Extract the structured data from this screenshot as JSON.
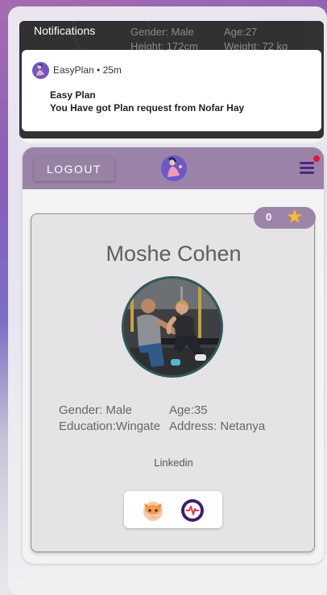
{
  "notification_shade": {
    "header": "Notifications",
    "underlay": {
      "gender": "Gender: Male",
      "age": "Age:27",
      "height": "Height: 172cm",
      "weight": "Weight: 72  kg"
    },
    "notification": {
      "app_name": "EasyPlan",
      "time": "25m",
      "app_line": "EasyPlan • 25m",
      "title": "Easy Plan",
      "body": "You Have got Plan request from Nofar Hay"
    }
  },
  "appbar": {
    "logout_label": "LOGOUT",
    "logo_icon": "easyplan-logo-icon",
    "menu_icon": "hamburger-menu-icon",
    "menu_badge_color": "#e3163a"
  },
  "profile": {
    "rating_count": "0",
    "rating_icon": "star-icon",
    "name": "Moshe Cohen",
    "photo": "trainer-photo",
    "gender": "Gender: Male",
    "age": "Age:35",
    "education": "Education:Wingate",
    "address": "Address: Netanya",
    "linkedin_label": "Linkedin",
    "action_icons": [
      "fox-avatar-icon",
      "heartbeat-icon"
    ]
  },
  "colors": {
    "appbar": "#9b82a7",
    "menu_icon": "#4b2880",
    "star": "#f6bf26",
    "avatar_border": "#2f5a5a"
  }
}
